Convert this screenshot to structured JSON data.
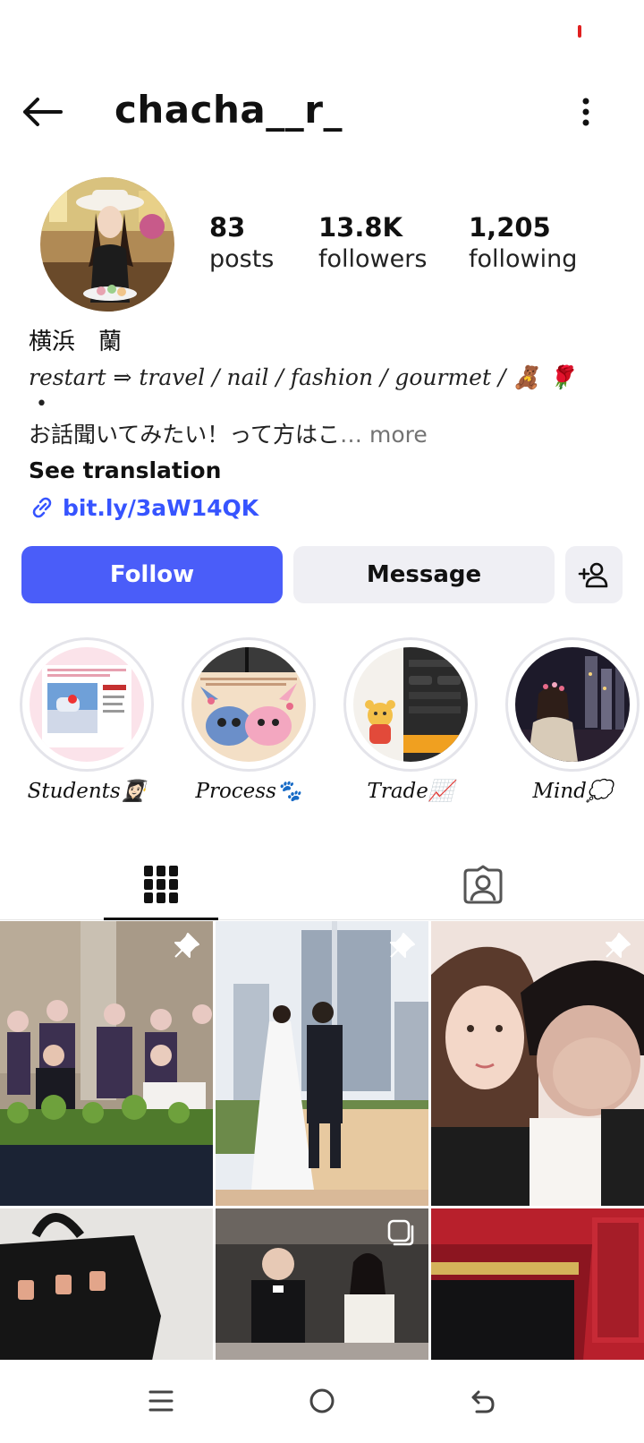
{
  "header": {
    "username": "chacha__r_"
  },
  "stats": {
    "posts_count": "83",
    "posts_label": "posts",
    "followers_count": "13.8K",
    "followers_label": "followers",
    "following_count": "1,205",
    "following_label": "following"
  },
  "bio": {
    "name": "横浜　蘭",
    "tagline": "restart ⇒ travel / nail / fashion / gourmet / 🧸 🌹",
    "bullet": "•",
    "text": "お話聞いてみたい！って方はこ",
    "ellipsis": "… ",
    "more_label": "more",
    "see_translation": "See translation",
    "link": "bit.ly/3aW14QK"
  },
  "actions": {
    "follow_label": "Follow",
    "message_label": "Message"
  },
  "highlights": [
    {
      "label": "Students👩🏻‍🎓"
    },
    {
      "label": "Process🐾"
    },
    {
      "label": "Trade📈"
    },
    {
      "label": "Mind💭"
    }
  ],
  "tabs": {
    "active": "grid"
  },
  "icons": {
    "back": "arrow-left-icon",
    "menu": "more-vertical-icon",
    "link": "link-icon",
    "add_user": "add-user-icon",
    "grid": "grid-icon",
    "tagged": "tagged-user-icon",
    "pin": "pin-icon",
    "carousel": "carousel-icon"
  },
  "colors": {
    "accent": "#4a5df9",
    "link": "#3654ff",
    "secondary_button": "#efeff4",
    "muted_text": "#737373",
    "status_dot": "#e02020"
  }
}
